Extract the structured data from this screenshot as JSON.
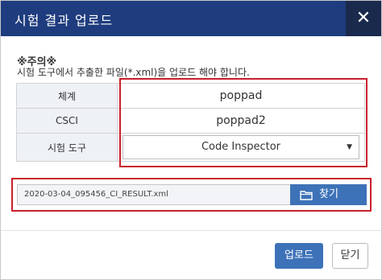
{
  "dialog": {
    "title": "시험 결과 업로드",
    "close_icon": "✕"
  },
  "notice": {
    "title": "※주의※",
    "text": "시험 도구에서 추출한 파일(*.xml)을 업로드 해야 합니다."
  },
  "form": {
    "rows": [
      {
        "label": "체계",
        "value": "poppad"
      },
      {
        "label": "CSCI",
        "value": "poppad2"
      },
      {
        "label": "시험 도구",
        "value": "Code Inspector"
      }
    ]
  },
  "file": {
    "name": "2020-03-04_095456_CI_RESULT.xml",
    "find_label": "찾기",
    "find_icon": "folder-icon"
  },
  "footer": {
    "upload_label": "업로드",
    "close_label": "닫기"
  },
  "colors": {
    "header": "#1e3c7e",
    "button": "#3d72b8",
    "highlight": "#c8202a"
  }
}
